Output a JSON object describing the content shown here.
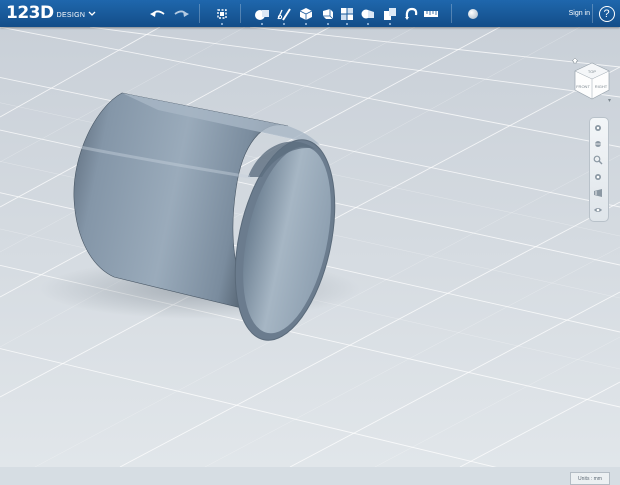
{
  "app": {
    "logo_text": "123D",
    "logo_sub": "DESIGN"
  },
  "toolbar": {
    "signin_label": "Sign in",
    "help_label": "?",
    "buttons": [
      "undo-icon",
      "redo-icon",
      "transform-icon",
      "primitives-icon",
      "sketch-icon",
      "construct-icon",
      "modify-icon",
      "pattern-icon",
      "grouping-icon",
      "combine-icon",
      "snap-icon",
      "measure-icon",
      "material-icon"
    ]
  },
  "viewcube": {
    "top_label": "TOP",
    "front_label": "FRONT",
    "right_label": "RIGHT"
  },
  "status": {
    "units_label": "Units : mm"
  },
  "colors": {
    "toolbar": "#1a5a9c",
    "grid_background": "#d6dde3",
    "model": "#8a9aaa"
  }
}
